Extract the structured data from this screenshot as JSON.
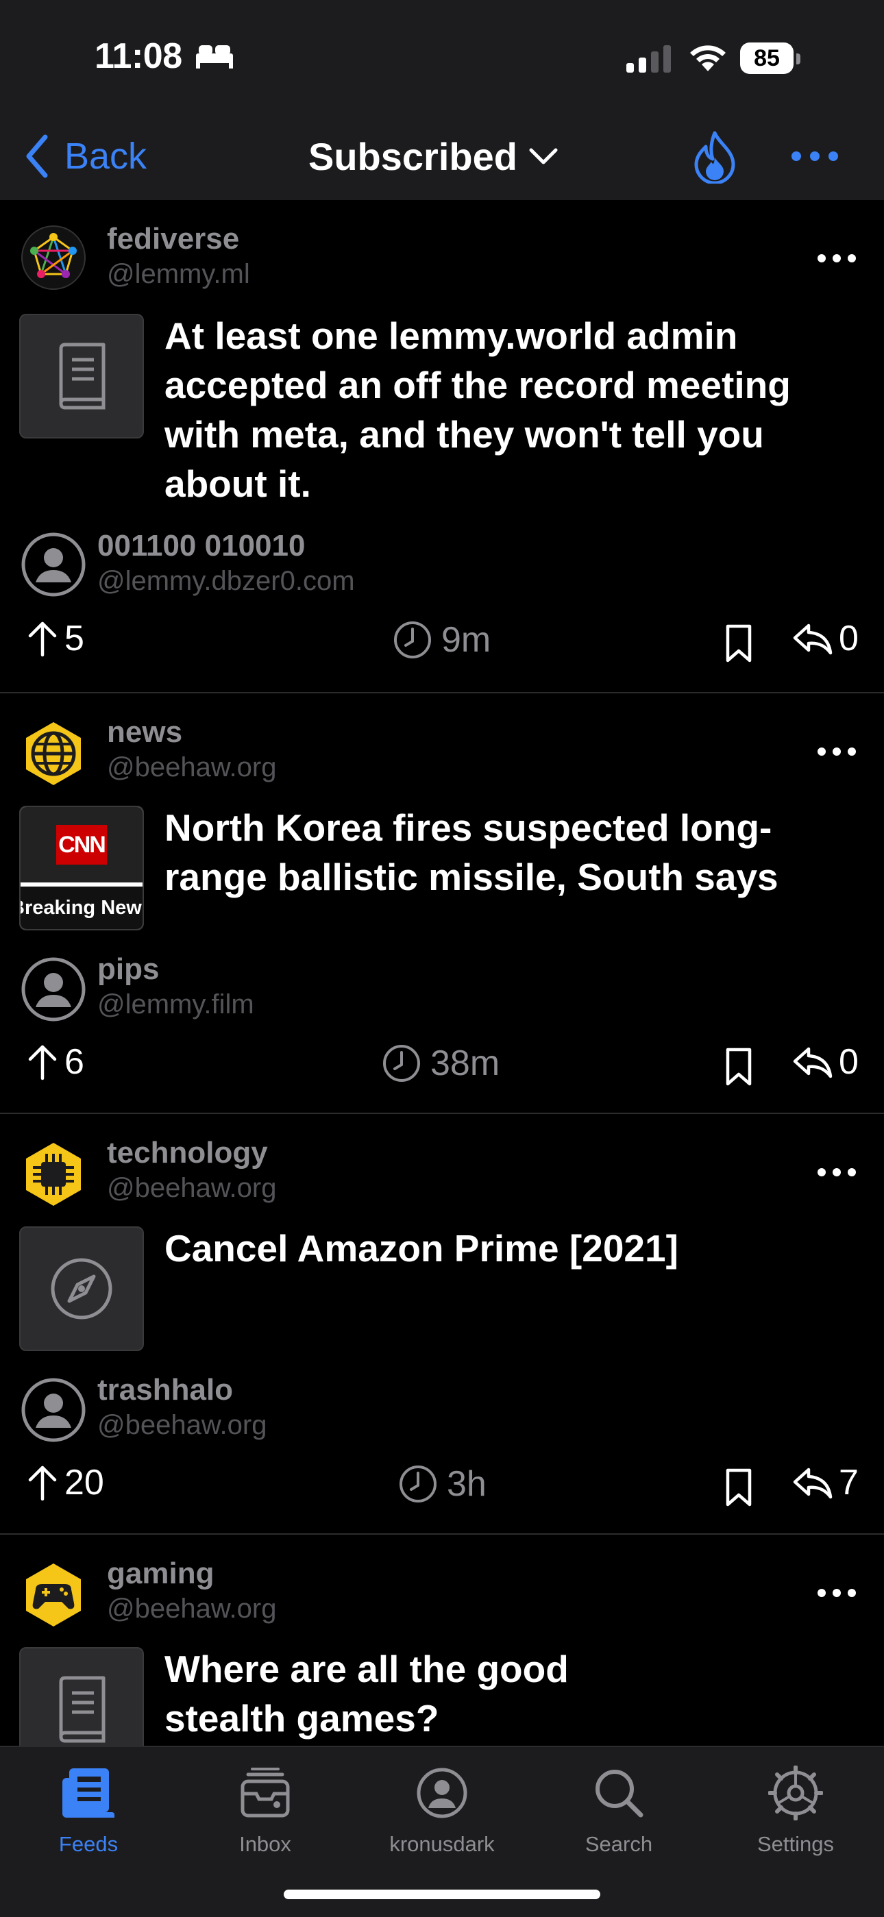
{
  "status": {
    "time": "11:08",
    "battery": "85"
  },
  "nav": {
    "back_label": "Back",
    "title": "Subscribed"
  },
  "posts": [
    {
      "community": "fediverse",
      "community_instance": "@lemmy.ml",
      "title": "At least one lemmy.world admin accepted an off the record meeting with meta, and they won't tell you about it.",
      "author": "001100 010010",
      "author_instance": "@lemmy.dbzer0.com",
      "votes": "5",
      "age": "9m",
      "replies": "0"
    },
    {
      "community": "news",
      "community_instance": "@beehaw.org",
      "title": "North Korea fires suspected long-range ballistic missile, South says",
      "thumb_logo": "CNN",
      "thumb_caption": "Breaking News",
      "author": "pips",
      "author_instance": "@lemmy.film",
      "votes": "6",
      "age": "38m",
      "replies": "0"
    },
    {
      "community": "technology",
      "community_instance": "@beehaw.org",
      "title": "Cancel Amazon Prime [2021]",
      "author": "trashhalo",
      "author_instance": "@beehaw.org",
      "votes": "20",
      "age": "3h",
      "replies": "7"
    },
    {
      "community": "gaming",
      "community_instance": "@beehaw.org",
      "title": "Where are all the good stealth games?"
    }
  ],
  "tabs": [
    {
      "label": "Feeds",
      "icon": "feeds-icon",
      "active": true
    },
    {
      "label": "Inbox",
      "icon": "inbox-icon"
    },
    {
      "label": "kronusdark",
      "icon": "profile-icon"
    },
    {
      "label": "Search",
      "icon": "search-icon"
    },
    {
      "label": "Settings",
      "icon": "settings-icon"
    }
  ],
  "colors": {
    "accent": "#3b82f6",
    "background": "#000000",
    "bar": "#1c1c1e",
    "muted": "#8e8e93",
    "beehaw": "#f5c518"
  }
}
